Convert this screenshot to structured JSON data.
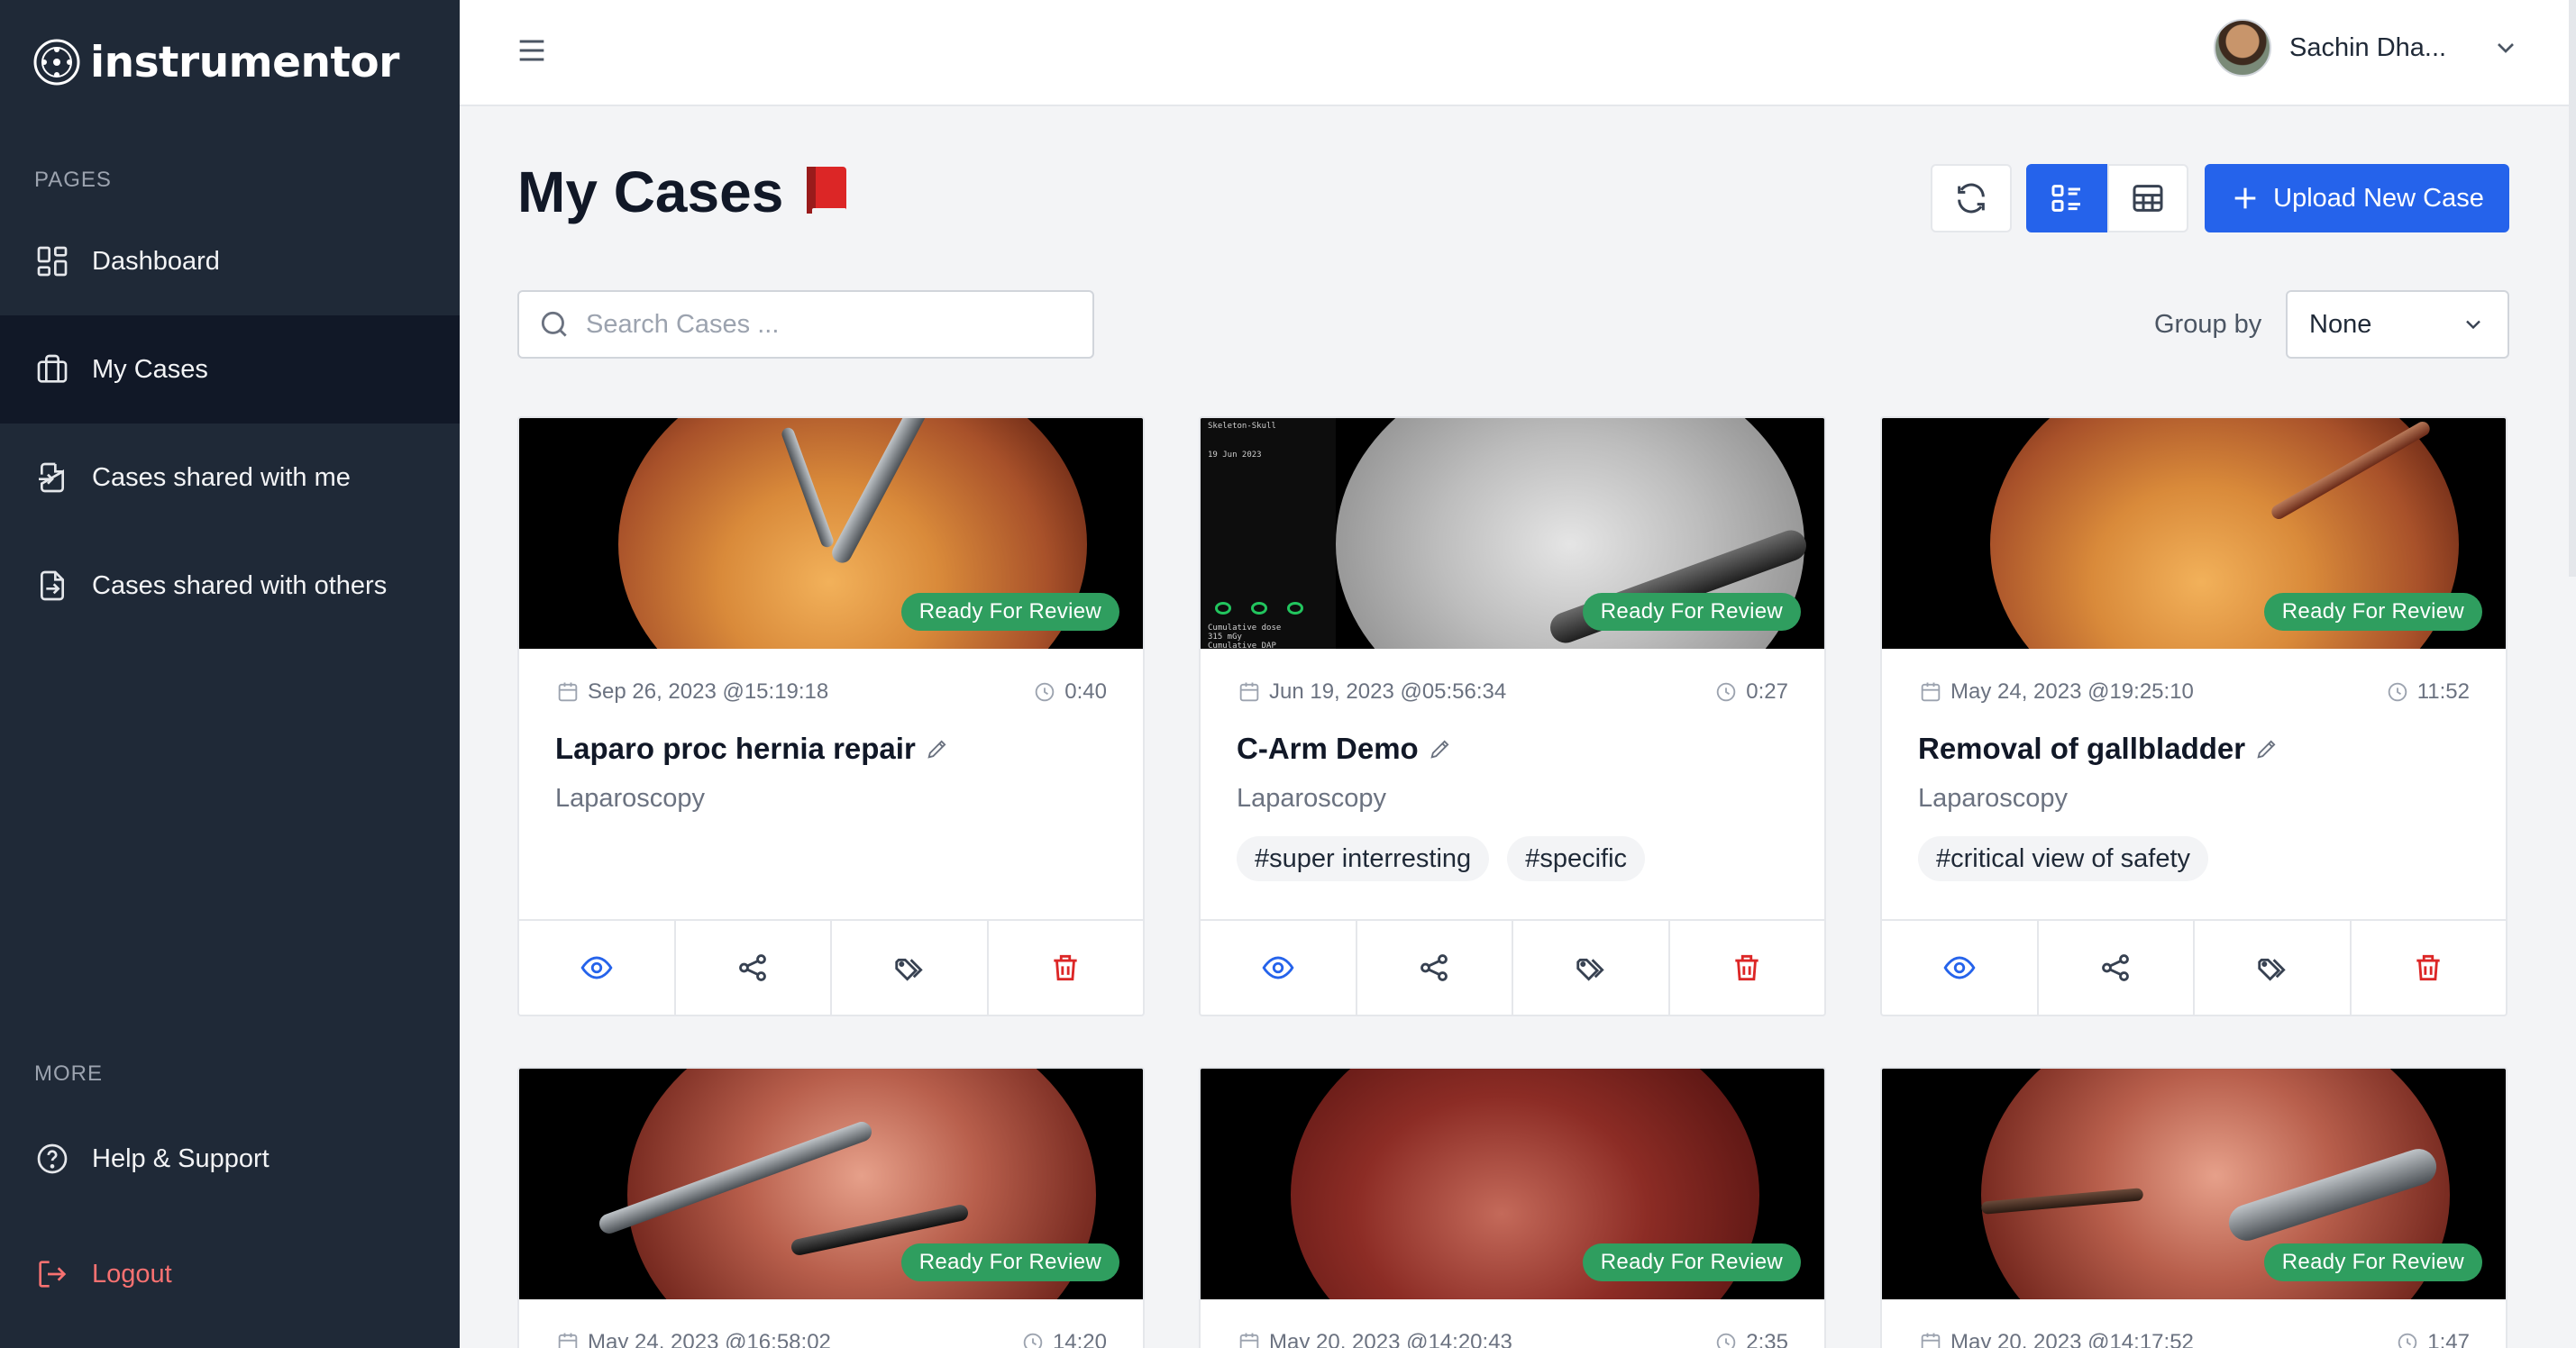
{
  "app": {
    "name": "instrumentor"
  },
  "sidebar": {
    "pages_label": "PAGES",
    "more_label": "MORE",
    "items": [
      {
        "label": "Dashboard",
        "icon": "dashboard-icon",
        "active": false
      },
      {
        "label": "My Cases",
        "icon": "briefcase-icon",
        "active": true
      },
      {
        "label": "Cases shared with me",
        "icon": "file-import-icon",
        "active": false
      },
      {
        "label": "Cases shared with others",
        "icon": "file-export-icon",
        "active": false
      }
    ],
    "more_items": [
      {
        "label": "Help & Support",
        "icon": "help-circle-icon"
      },
      {
        "label": "Logout",
        "icon": "logout-icon",
        "color": "#f87171"
      }
    ]
  },
  "topbar": {
    "user_name": "Sachin Dha..."
  },
  "page": {
    "title": "My Cases",
    "title_icon": "red-book-icon",
    "upload_label": "Upload New Case",
    "search_placeholder": "Search Cases ...",
    "group_by_label": "Group by",
    "group_by_value": "None"
  },
  "colors": {
    "sidebar_bg": "#1f2937",
    "sidebar_active_bg": "#111827",
    "accent": "#2563eb",
    "status_badge": "#2f9e5f",
    "delete": "#dc2626",
    "view": "#2563eb"
  },
  "cases": [
    {
      "date": "Sep 26, 2023 @15:19:18",
      "duration": "0:40",
      "title": "Laparo proc hernia repair",
      "type": "Laparoscopy",
      "status": "Ready For Review",
      "tags": []
    },
    {
      "date": "Jun 19, 2023 @05:56:34",
      "duration": "0:27",
      "title": "C-Arm Demo",
      "type": "Laparoscopy",
      "status": "Ready For Review",
      "tags": [
        "#super interresting",
        "#specific"
      ],
      "overlay": {
        "line1": "Skeleton-Skull",
        "line2": "19 Jun 2023",
        "line3": "Cumulative dose",
        "line4": "315 mGy",
        "line5": "Cumulative DAP"
      }
    },
    {
      "date": "May 24, 2023 @19:25:10",
      "duration": "11:52",
      "title": "Removal of gallbladder",
      "type": "Laparoscopy",
      "status": "Ready For Review",
      "tags": [
        "#critical view of safety"
      ]
    },
    {
      "date": "May 24, 2023 @16:58:02",
      "duration": "14:20",
      "status": "Ready For Review"
    },
    {
      "date": "May 20, 2023 @14:20:43",
      "duration": "2:35",
      "status": "Ready For Review"
    },
    {
      "date": "May 20, 2023 @14:17:52",
      "duration": "1:47",
      "status": "Ready For Review"
    }
  ]
}
